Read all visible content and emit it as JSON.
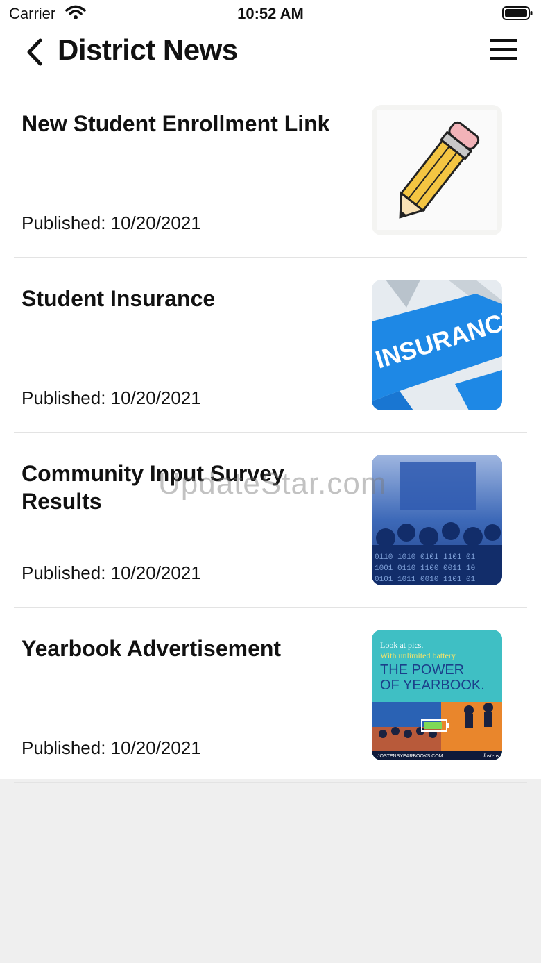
{
  "status_bar": {
    "carrier": "Carrier",
    "time": "10:52 AM"
  },
  "nav": {
    "title": "District News"
  },
  "news": [
    {
      "title": "New Student Enrollment Link",
      "published": "Published: 10/20/2021",
      "thumbnail": "pencil-image"
    },
    {
      "title": "Student Insurance",
      "published": "Published: 10/20/2021",
      "thumbnail": "insurance-image",
      "thumbnail_text": "INSURANCE"
    },
    {
      "title": "Community Input Survey Results",
      "published": "Published: 10/20/2021",
      "thumbnail": "audience-image"
    },
    {
      "title": "Yearbook Advertisement",
      "published": "Published: 10/20/2021",
      "thumbnail": "yearbook-image",
      "thumbnail_text": {
        "line1": "Look at pics.",
        "line2": "With unlimited battery.",
        "line3": "THE POWER",
        "line4": "OF YEARBOOK.",
        "footer": "JOSTENSYEARBOOKS.COM",
        "brand": "Jostens"
      }
    }
  ],
  "watermark": "UpdateStar.com",
  "colors": {
    "background": "#ffffff",
    "footer_area": "#efefef",
    "divider": "#e3e3e3",
    "insurance_blue": "#1e88e5",
    "yearbook_teal": "#3fbfc4"
  }
}
